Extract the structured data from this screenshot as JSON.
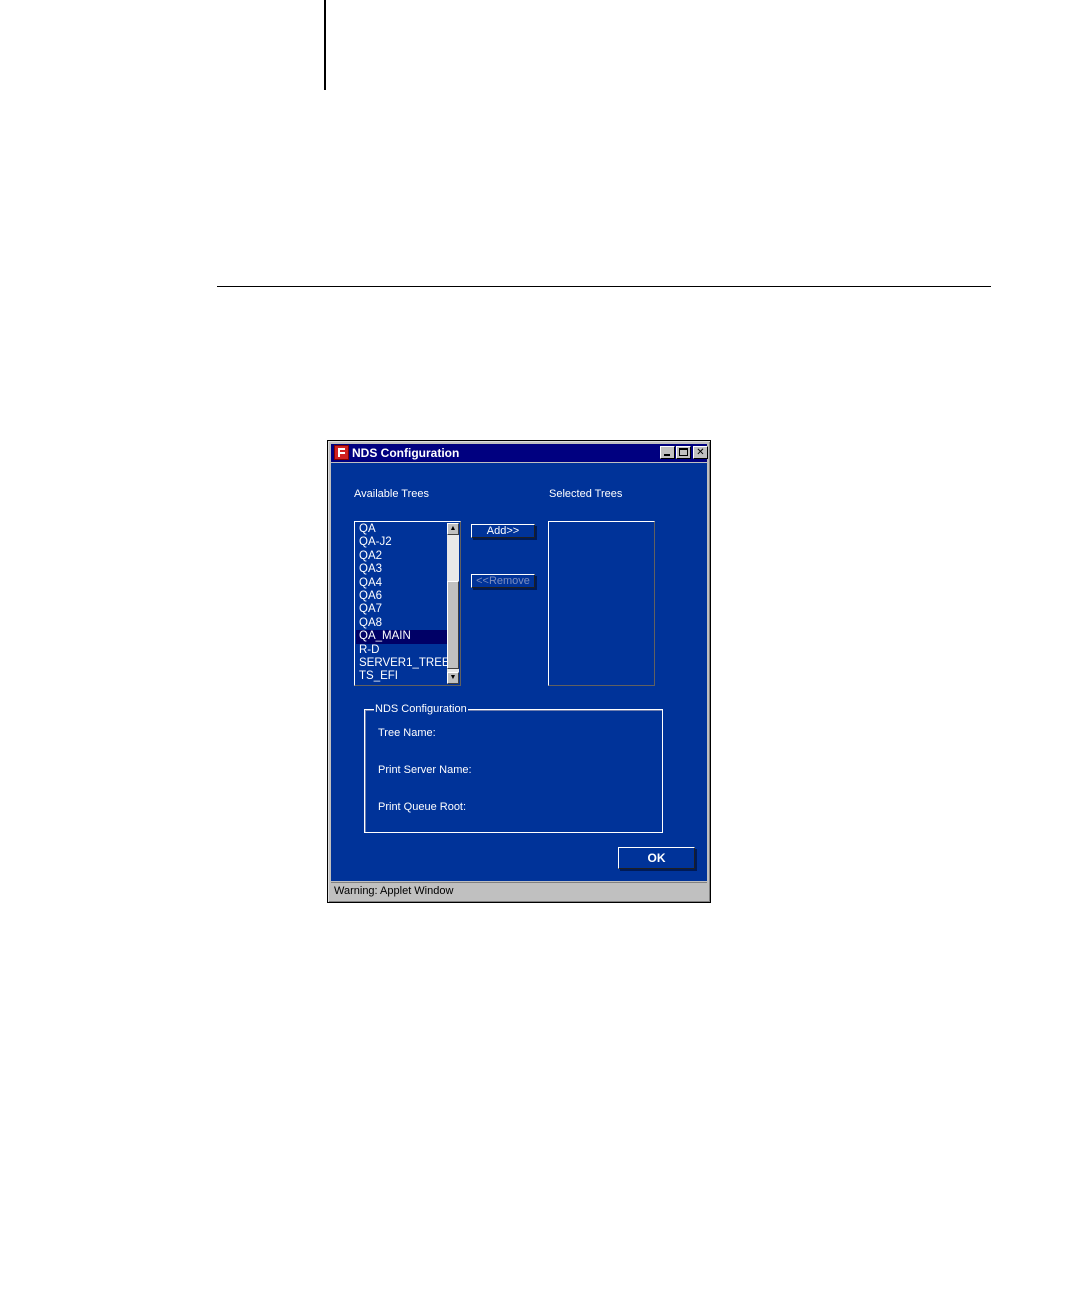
{
  "window": {
    "title": "NDS Configuration",
    "status": "Warning: Applet Window"
  },
  "available": {
    "label": "Available Trees",
    "items": [
      "QA",
      "QA-J2",
      "QA2",
      "QA3",
      "QA4",
      "QA6",
      "QA7",
      "QA8",
      "QA_MAIN",
      "R-D",
      "SERVER1_TREE",
      "TS_EFI"
    ],
    "selected_item": "QA_MAIN"
  },
  "selected": {
    "label": "Selected Trees"
  },
  "buttons": {
    "add": "Add>>",
    "remove": "<<Remove",
    "ok": "OK"
  },
  "config_group": {
    "legend": "NDS Configuration",
    "tree_name": "Tree Name:",
    "print_server_name": "Print Server Name:",
    "print_queue_root": "Print Queue Root:"
  },
  "colors": {
    "dialog_background": "#003399",
    "title_bar": "#000080",
    "selection": "#000066"
  }
}
